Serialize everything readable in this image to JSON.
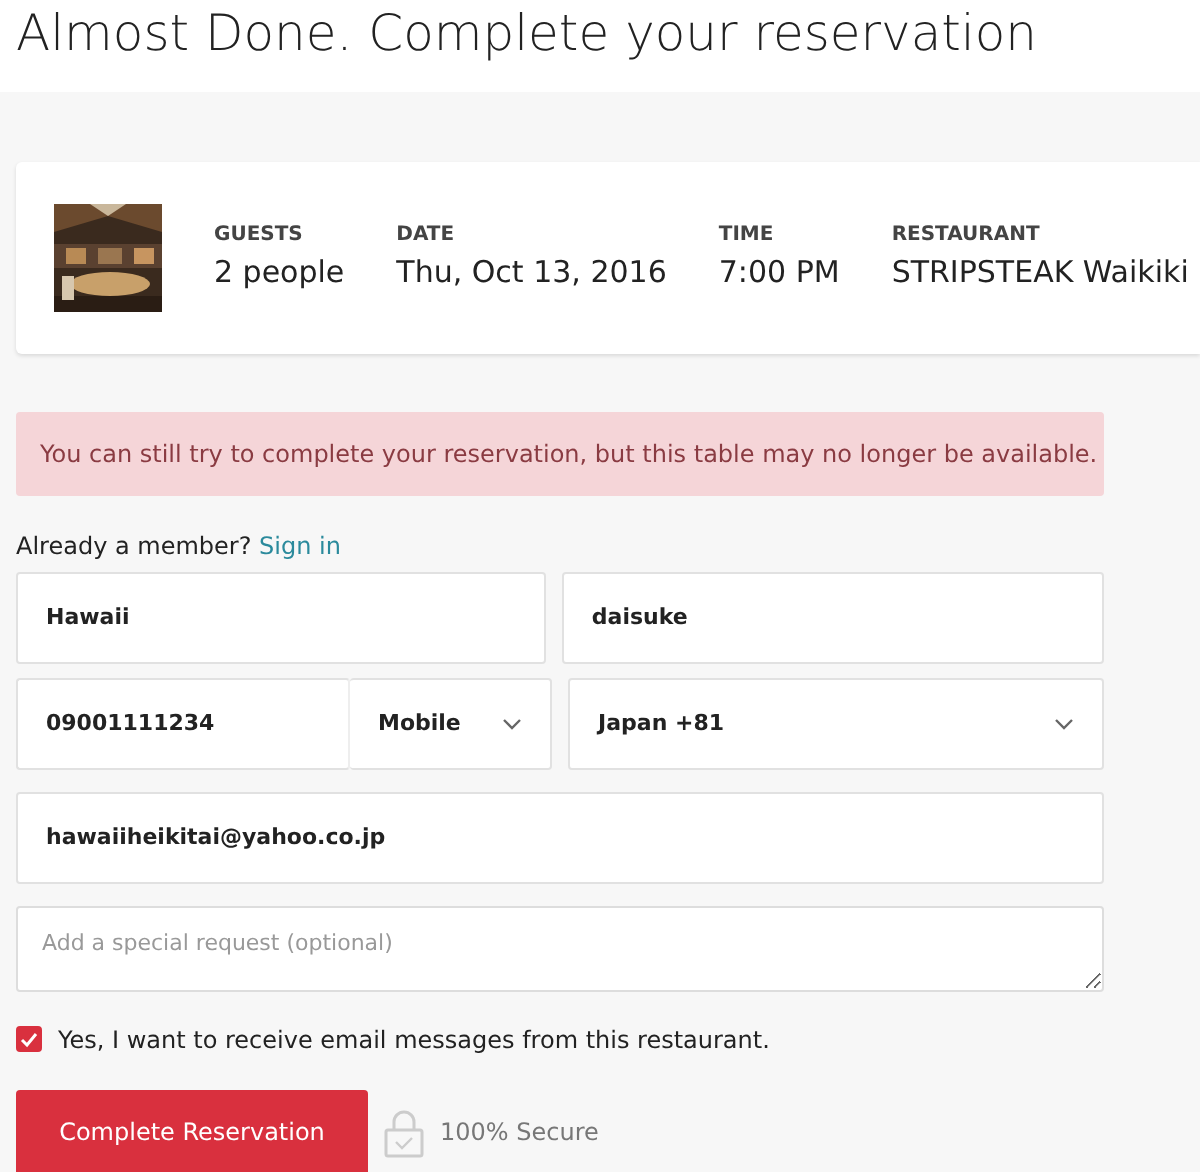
{
  "title": "Almost Done. Complete your reservation",
  "summary": [
    {
      "label": "GUESTS",
      "value": "2 people"
    },
    {
      "label": "DATE",
      "value": "Thu, Oct 13, 2016"
    },
    {
      "label": "TIME",
      "value": "7:00 PM"
    },
    {
      "label": "RESTAURANT",
      "value": "STRIPSTEAK Waikiki"
    }
  ],
  "alert": "You can still try to complete your reservation, but this table may no longer be available.",
  "member_prompt": "Already a member?",
  "sign_in": "Sign in",
  "fields": [
    {
      "kind": "text",
      "value": "Hawaii"
    },
    {
      "kind": "text",
      "value": "daisuke"
    },
    {
      "kind": "text",
      "value": "09001111234"
    },
    {
      "kind": "select",
      "value": "Mobile"
    },
    {
      "kind": "select",
      "value": "Japan +81"
    },
    {
      "kind": "text",
      "value": "hawaiiheikitai@yahoo.co.jp"
    }
  ],
  "special_request": {
    "placeholder": "Add a special request (optional)"
  },
  "email_optin": {
    "label": "Yes, I want to receive email messages from this restaurant.",
    "checked": true
  },
  "submit": "Complete Reservation",
  "secure": "100% Secure"
}
